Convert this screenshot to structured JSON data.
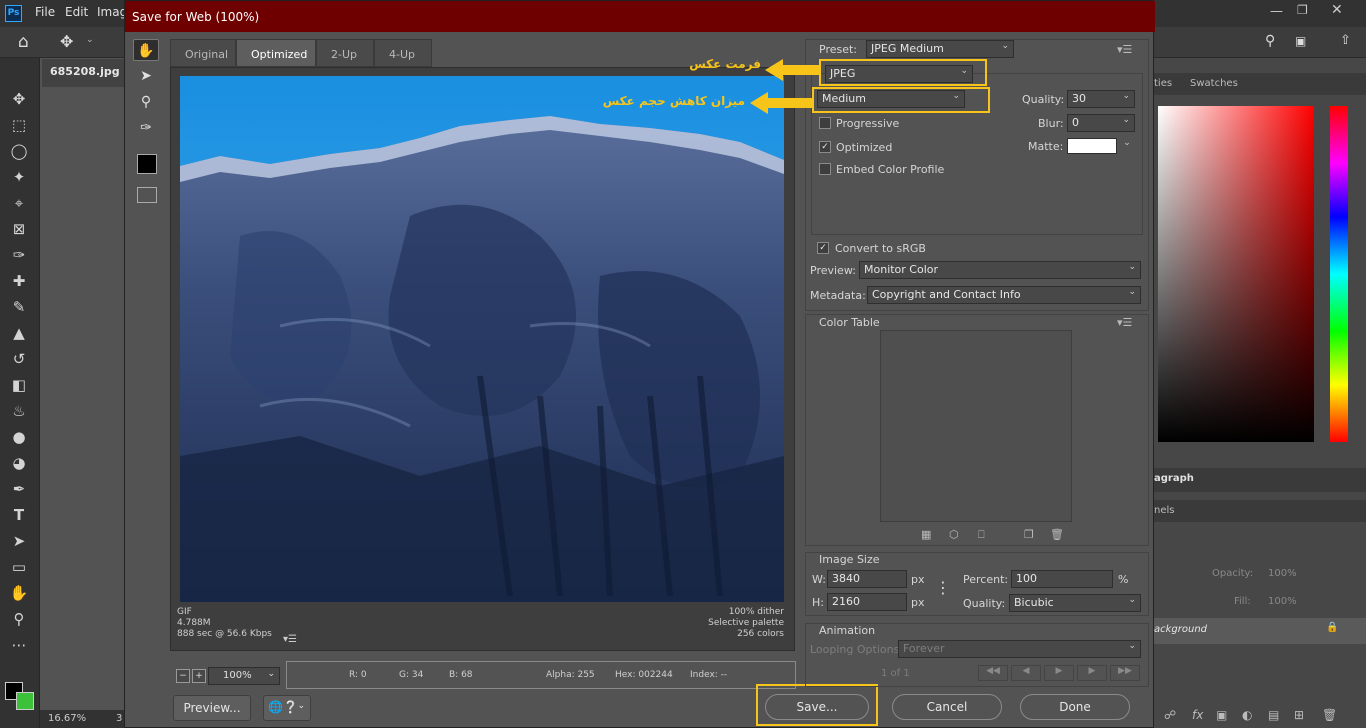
{
  "ps": {
    "logo": "Ps",
    "menu": [
      "File",
      "Edit",
      "Imag"
    ],
    "doc_tab": "685208.jpg @",
    "zoom_status": "16.67%",
    "status_extra": "3",
    "right_tabs": [
      "ties",
      "Swatches"
    ],
    "paragraph_tab": "agraph",
    "channels_tab": "nels",
    "opacity_label": "Opacity:",
    "opacity_value": "100%",
    "fill_label": "Fill:",
    "fill_value": "100%",
    "layer_name": "ackground"
  },
  "dialog": {
    "title": "Save for Web (100%)",
    "view_tabs": [
      "Original",
      "Optimized",
      "2-Up",
      "4-Up"
    ],
    "active_tab": "Optimized",
    "image_info_left": [
      "GIF",
      "4.788M",
      "888 sec @ 56.6 Kbps"
    ],
    "image_info_right": [
      "100% dither",
      "Selective palette",
      "256 colors"
    ],
    "zoom": "100%",
    "pixel_info": {
      "r": "R: 0",
      "g": "G: 34",
      "b": "B: 68",
      "alpha": "Alpha: 255",
      "hex": "Hex: 002244",
      "index": "Index: --"
    },
    "buttons": {
      "preview": "Preview...",
      "save": "Save...",
      "cancel": "Cancel",
      "done": "Done"
    }
  },
  "settings": {
    "preset_label": "Preset:",
    "preset_value": "JPEG Medium",
    "format_value": "JPEG",
    "quality_level": "Medium",
    "quality_label": "Quality:",
    "quality_value": "30",
    "blur_label": "Blur:",
    "blur_value": "0",
    "matte_label": "Matte:",
    "progressive": "Progressive",
    "optimized": "Optimized",
    "embed_profile": "Embed Color Profile",
    "convert_srgb": "Convert to sRGB",
    "preview_label": "Preview:",
    "preview_value": "Monitor Color",
    "metadata_label": "Metadata:",
    "metadata_value": "Copyright and Contact Info",
    "color_table_label": "Color Table",
    "image_size_label": "Image Size",
    "w_label": "W:",
    "w_value": "3840",
    "h_label": "H:",
    "h_value": "2160",
    "px_unit": "px",
    "percent_label": "Percent:",
    "percent_value": "100",
    "percent_unit": "%",
    "resample_label": "Quality:",
    "resample_value": "Bicubic",
    "animation_label": "Animation",
    "looping_label": "Looping Options:",
    "looping_value": "Forever",
    "frame_counter": "1 of 1"
  },
  "annotations": {
    "format_note": "فرمت عکس",
    "quality_note": "میزان کاهش حجم عکس"
  },
  "colors": {
    "title_bar": "#6e0000",
    "highlight": "#f7c519"
  }
}
